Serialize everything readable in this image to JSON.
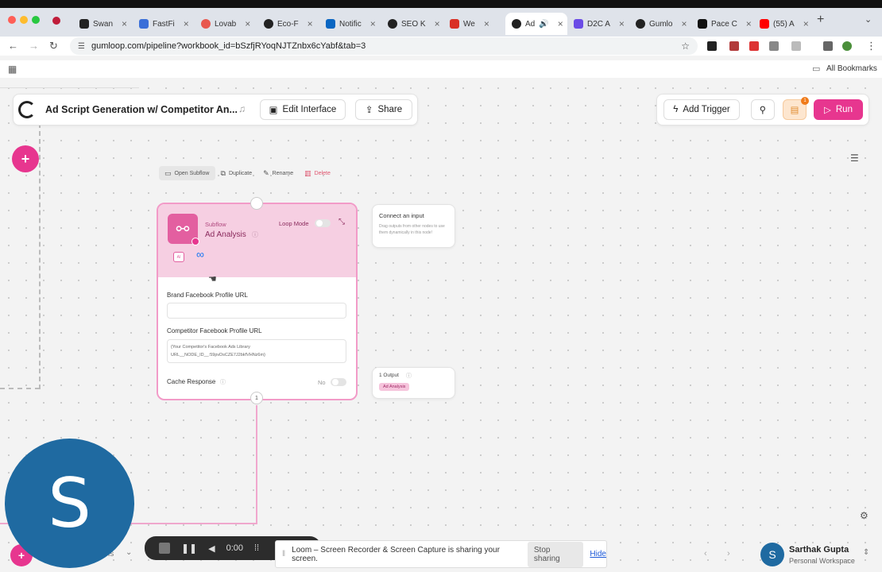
{
  "browser": {
    "tabs": [
      {
        "label": "Swan",
        "color": "#222222"
      },
      {
        "label": "FastFi",
        "color": "#3b6fd8"
      },
      {
        "label": "Lovab",
        "color": "#e8584f"
      },
      {
        "label": "Eco-F",
        "color": "#222222"
      },
      {
        "label": "Notific",
        "color": "#0a66c2"
      },
      {
        "label": "SEO K",
        "color": "#222222"
      },
      {
        "label": "We",
        "color": "#d93025"
      },
      {
        "label": "Ad",
        "color": "#222222"
      },
      {
        "label": "D2C A",
        "color": "#6b4ce6"
      },
      {
        "label": "Gumlo",
        "color": "#222222"
      },
      {
        "label": "Pace C",
        "color": "#111111"
      },
      {
        "label": "(55) A",
        "color": "#ff0000"
      }
    ],
    "url": "gumloop.com/pipeline?workbook_id=bSzfjRYoqNJTZnbx6cYabf&tab=3",
    "bookmarks_label": "All Bookmarks"
  },
  "app": {
    "title": "Ad Script Generation w/ Competitor An...",
    "edit_interface": "Edit Interface",
    "share": "Share",
    "add_trigger": "Add Trigger",
    "run": "Run",
    "badge": "1"
  },
  "subflow_toolbar": {
    "open": "Open Subflow",
    "duplicate": "Duplicate",
    "rename": "Rename",
    "delete": "Delete"
  },
  "node": {
    "type": "Subflow",
    "name": "Ad Analysis",
    "loop_mode": "Loop Mode",
    "ai_badge": "AI",
    "field1_label": "Brand Facebook Profile URL",
    "field1_value": "",
    "field2_label": "Competitor Facebook Profile URL",
    "field2_value": "{Your Competitor's Facebook Ads Library URL__NODE_ID__:59pvDsCZE7J2bkfVHNz6m}",
    "cache_label": "Cache Response",
    "cache_value": "No",
    "top_handle": "",
    "bottom_handle": "1"
  },
  "connect": {
    "title": "Connect an input",
    "desc": "Drag outputs from other nodes to use them dynamically in this node!"
  },
  "output": {
    "label": "1 Output",
    "chip": "Ad Analysis"
  },
  "avatar_letter": "S",
  "loom": {
    "time": "0:00",
    "message": "Loom – Screen Recorder & Screen Capture is sharing your screen.",
    "stop": "Stop sharing",
    "hide": "Hide"
  },
  "user": {
    "initial": "S",
    "name": "Sarthak Gupta",
    "workspace": "Personal Workspace"
  },
  "bottom_left_fragment": "is"
}
